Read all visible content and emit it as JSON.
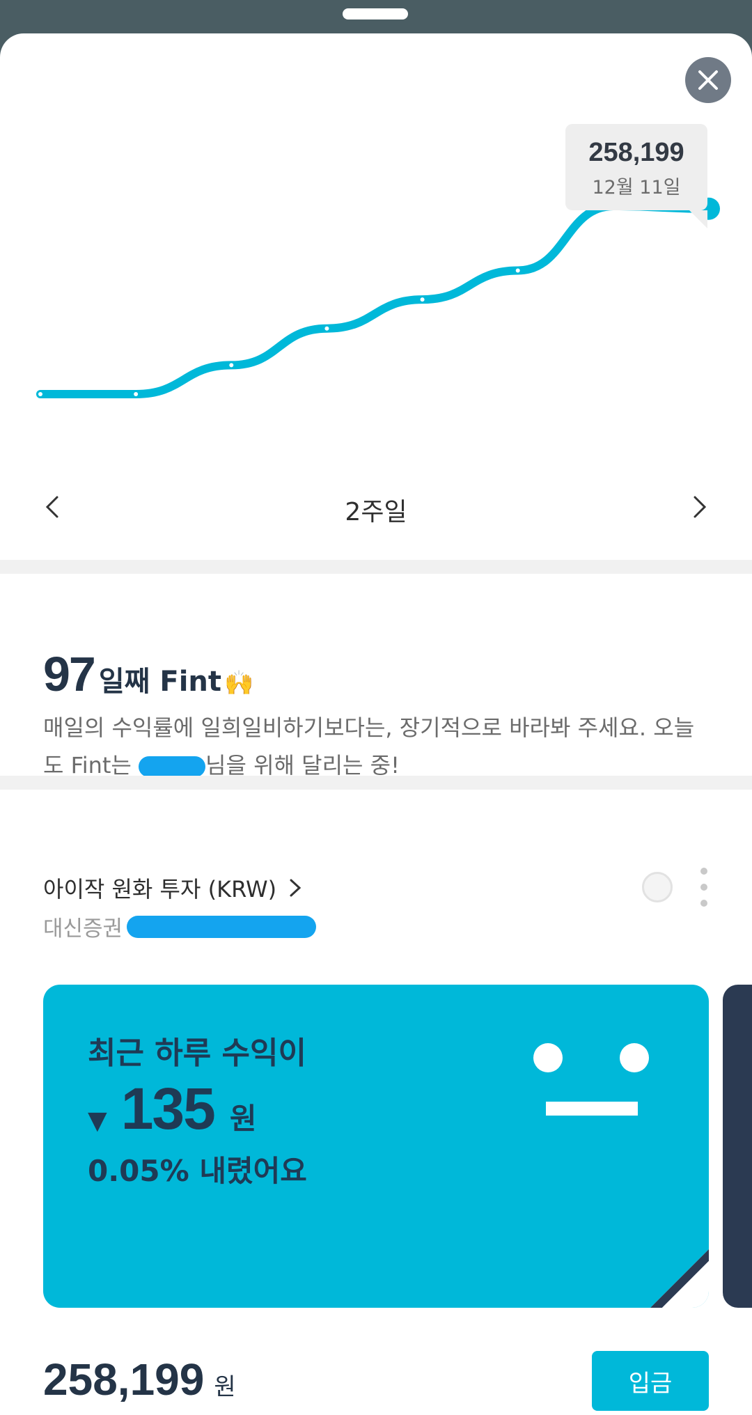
{
  "sheet": {
    "close_icon": "close-icon"
  },
  "chart_data": {
    "type": "line",
    "x": [
      "1",
      "2",
      "3",
      "4",
      "5",
      "6",
      "7",
      "8"
    ],
    "values": [
      248600,
      248600,
      250100,
      252000,
      253500,
      255000,
      258334,
      258199
    ],
    "series_color": "#00b8d9",
    "tooltip": {
      "value": "258,199",
      "date": "12월 11일"
    }
  },
  "period": {
    "label": "2주일",
    "prev_icon": "chevron-left-icon",
    "next_icon": "chevron-right-icon"
  },
  "day_counter": {
    "number": "97",
    "suffix": "일째 Fint",
    "emoji": "🙌",
    "message_part1": "매일의 수익률에 일희일비하기보다는, 장기적으로 바라봐 주세요. 오늘도 Fint는 ",
    "message_part2": "님을 위해 달리는 중!"
  },
  "account": {
    "name": "아이작 원화 투자 (KRW)",
    "broker": "대신증권",
    "card": {
      "line1": "최근 하루 수익이",
      "arrow": "▼",
      "amount": "135",
      "unit": "원",
      "line3": "0.05% 내렸어요",
      "color": "#00b8d9"
    },
    "balance": {
      "amount": "258,199",
      "unit": "원"
    },
    "deposit_label": "입금"
  }
}
